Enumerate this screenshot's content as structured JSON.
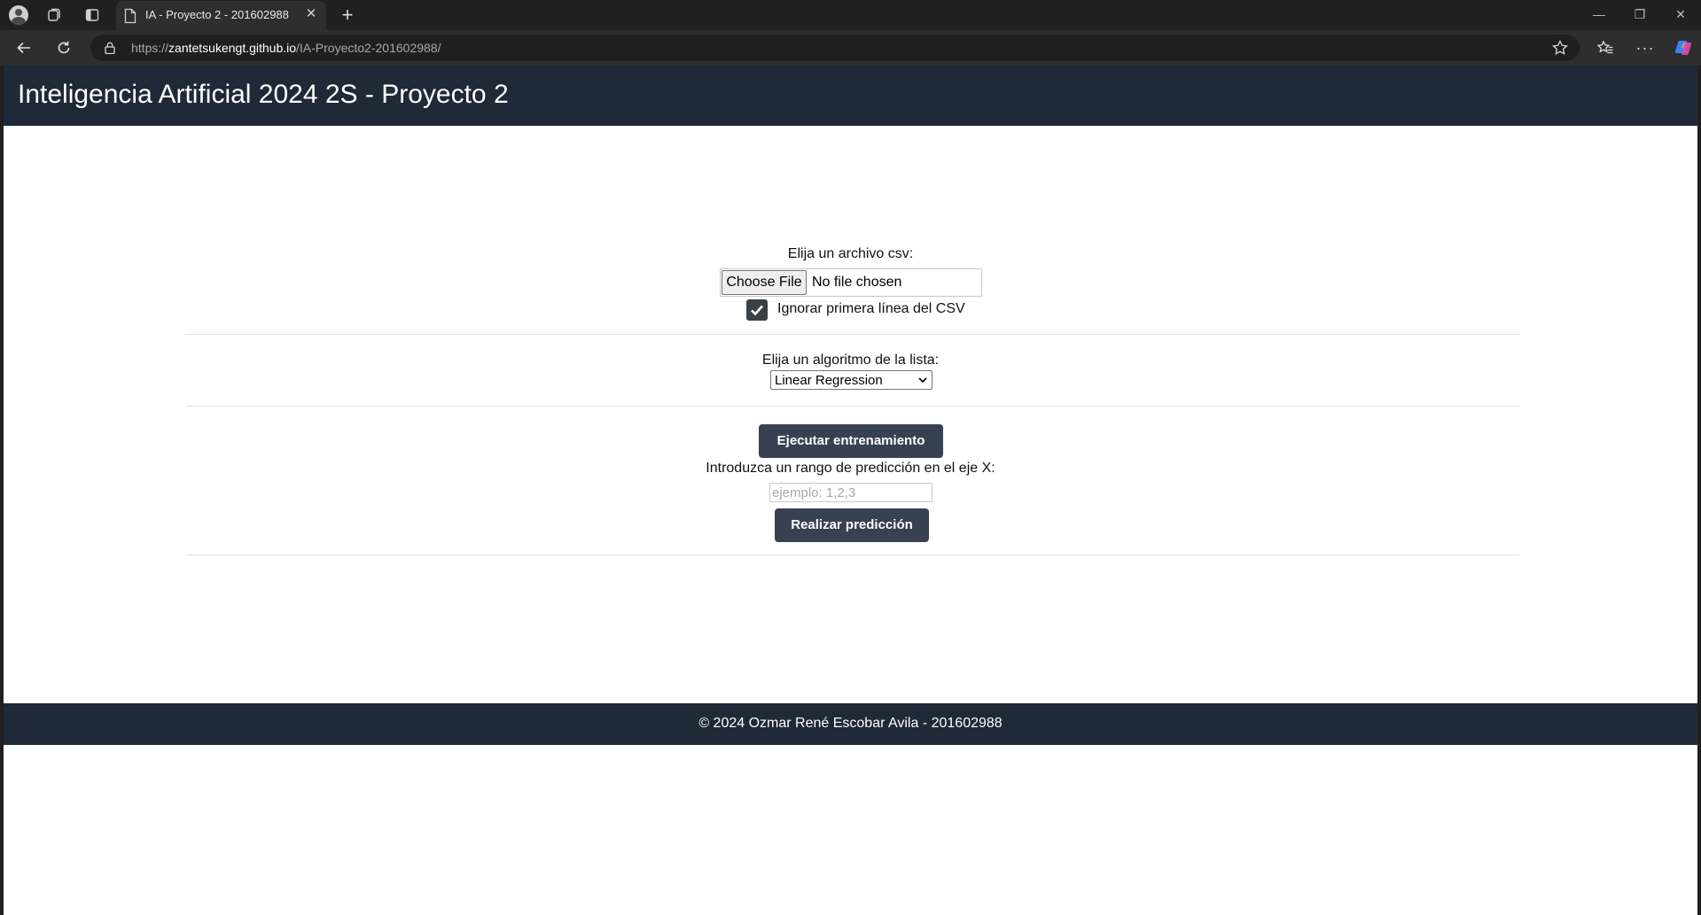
{
  "browser": {
    "tab_title": "IA - Proyecto 2 - 201602988",
    "tab_close": "✕",
    "new_tab": "+",
    "url_prefix": "https://",
    "url_host": "zantetsukengt.github.io",
    "url_path": "/IA-Proyecto2-201602988/",
    "more": "···"
  },
  "header": {
    "title": "Inteligencia Artificial 2024 2S - Proyecto 2"
  },
  "file_section": {
    "label": "Elija un archivo csv:",
    "button_label": "Choose File",
    "status": "No file chosen",
    "checkbox_label": "Ignorar primera línea del CSV",
    "checkbox_checked": true
  },
  "algorithm_section": {
    "label": "Elija un algoritmo de la lista:",
    "selected": "Linear Regression"
  },
  "actions": {
    "train_label": "Ejecutar entrenamiento",
    "range_label": "Introduzca un rango de predicción en el eje X:",
    "range_placeholder": "ejemplo: 1,2,3",
    "predict_label": "Realizar predicción"
  },
  "footer": {
    "text": "© 2024 Ozmar René Escobar Avila - 201602988"
  },
  "colors": {
    "header_bg": "#1f2937",
    "button_bg": "#374151"
  }
}
